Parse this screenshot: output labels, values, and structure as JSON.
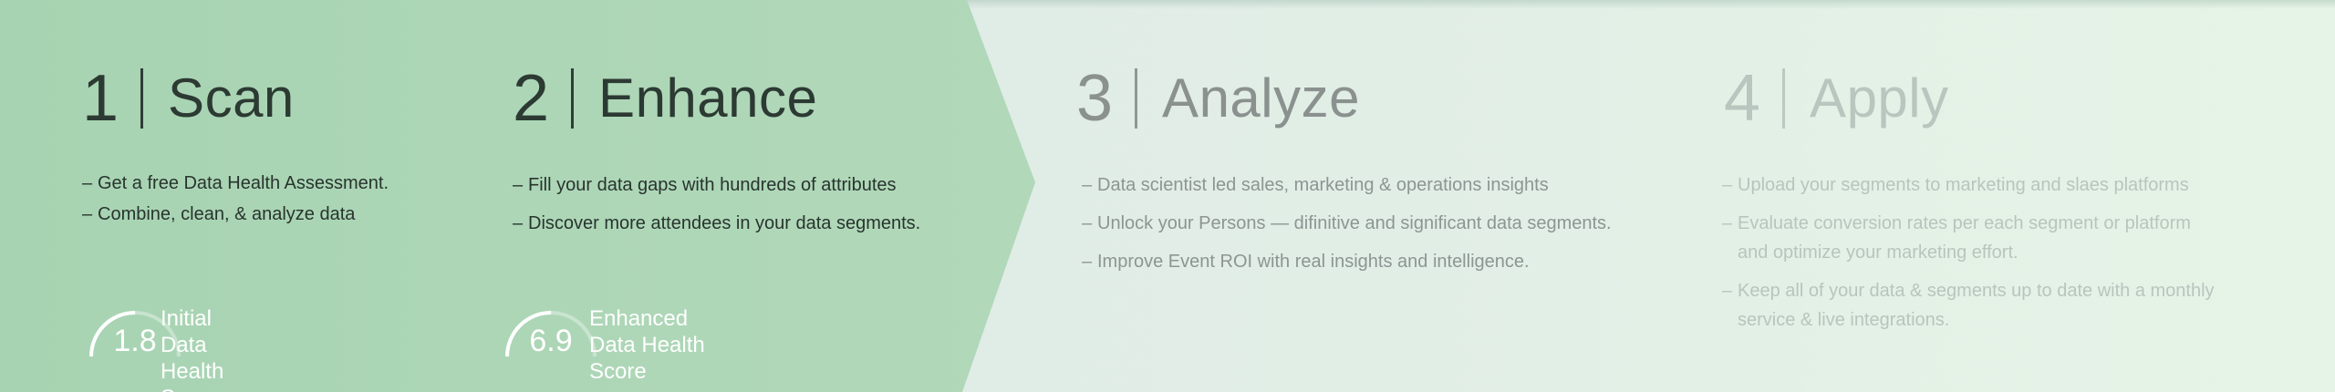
{
  "steps": [
    {
      "number": "1",
      "title": "Scan",
      "bullets": [
        [
          "Get a free Data Health Assessment."
        ],
        [
          "Combine, clean, & analyze data"
        ]
      ],
      "score": {
        "value": "1.8",
        "fraction": 0.5,
        "label_line1": "Initial",
        "label_line2": "Data Health Score"
      }
    },
    {
      "number": "2",
      "title": "Enhance",
      "bullets": [
        [
          "Fill your data gaps with hundreds of attributes"
        ],
        [
          "Discover more attendees in your data segments."
        ]
      ],
      "score": {
        "value": "6.9",
        "fraction": 0.5,
        "label_line1": "Enhanced",
        "label_line2": "Data Health Score"
      }
    },
    {
      "number": "3",
      "title": "Analyze",
      "bullets": [
        [
          "Data scientist led sales, marketing & operations insights"
        ],
        [
          "Unlock your Persons — difinitive and significant data segments."
        ],
        [
          "Improve Event ROI with real insights and intelligence."
        ]
      ]
    },
    {
      "number": "4",
      "title": "Apply",
      "bullets": [
        [
          "Upload your segments to marketing and slaes platforms"
        ],
        [
          "Evaluate conversion rates per each segment or platform",
          "and optimize your marketing effort."
        ],
        [
          "Keep all of your data & segments up to date with a monthly",
          "service & live integrations."
        ]
      ]
    }
  ],
  "colors": {
    "green_panel": "#acd6b6",
    "dark_text": "#2c3a33",
    "mid_text": "#8a918e",
    "light_text": "#b9c6bf",
    "score_text": "#ffffff"
  },
  "bullet_dash": "–"
}
